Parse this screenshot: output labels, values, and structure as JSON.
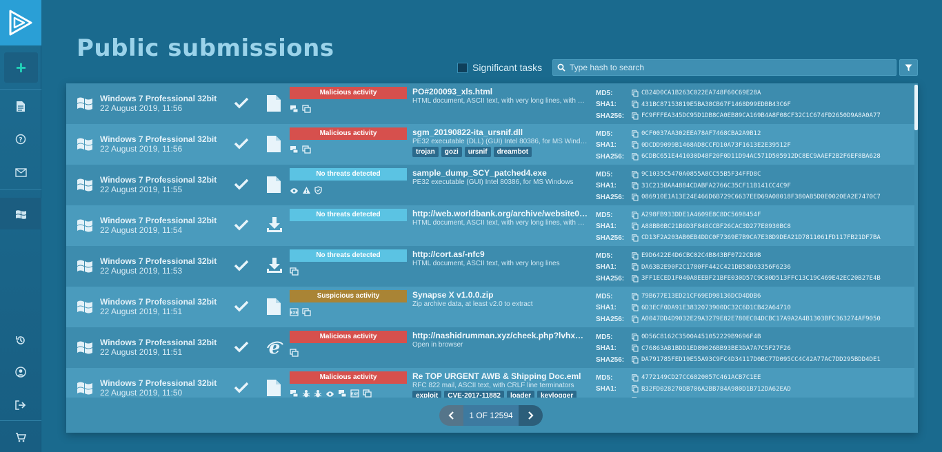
{
  "page": {
    "title": "Public submissions"
  },
  "toolbar": {
    "significant_label": "Significant tasks",
    "search_placeholder": "Type hash to search"
  },
  "hash_labels": {
    "md5": "MD5:",
    "sha1": "SHA1:",
    "sha256": "SHA256:"
  },
  "colors": {
    "malicious": "#d6504d",
    "clean": "#5bc3e3",
    "suspicious": "#a98435"
  },
  "tasks": [
    {
      "os": "Windows 7 Professional 32bit",
      "date": "22 August 2019, 11:56",
      "filetype": "document",
      "verdict": "Malicious activity",
      "verdict_type": "malicious",
      "name": "PO#200093_xls.html",
      "desc": "HTML document, ASCII text, with very long lines, with C...",
      "icons": [
        "network-icon",
        "copy-icon"
      ],
      "tags": [],
      "md5": "CB24D0CA1B263C022EA748F60C69E28A",
      "sha1": "431BC87153819E5BA38CB67F1468D99EDBB43C6F",
      "sha256": "FC9FFFEA345DC95D1DB8CA0EB89CA169B4A8F08CF32C1C674FD2650D9A8A0A77"
    },
    {
      "os": "Windows 7 Professional 32bit",
      "date": "22 August 2019, 11:56",
      "filetype": "document",
      "verdict": "Malicious activity",
      "verdict_type": "malicious",
      "name": "sgm_20190822-ita_ursnif.dll",
      "desc": "PE32 executable (DLL) (GUI) Intel 80386, for MS Windo...",
      "icons": [
        "network-icon",
        "copy-icon"
      ],
      "tags": [
        "trojan",
        "gozi",
        "ursnif",
        "dreambot"
      ],
      "md5": "0CF0037AA302EEA78AF7468CBA2A9B12",
      "sha1": "0DCDD9099B1468AD8CCFD10A73F1613E2E39512F",
      "sha256": "6CDBC651E441030D48F20F0D11D94AC571D505912DC8EC9AAEF2B2F6EF8BA628"
    },
    {
      "os": "Windows 7 Professional 32bit",
      "date": "22 August 2019, 11:55",
      "filetype": "document",
      "verdict": "No threats detected",
      "verdict_type": "clean",
      "name": "sample_dump_SCY_patched4.exe",
      "desc": "PE32 executable (GUI) Intel 80386, for MS Windows",
      "icons": [
        "eye-icon",
        "warning-icon",
        "shield-icon"
      ],
      "tags": [],
      "md5": "9C1035C5470A0855A8CC55B5F34FFD8C",
      "sha1": "31C215BAA4884CDABFA2766C35CF11B141CC4C9F",
      "sha256": "086910E1A13E24E466D6B729C6637EED69A08018F380AB5D0E0020EA2E7470C7"
    },
    {
      "os": "Windows 7 Professional 32bit",
      "date": "22 August 2019, 11:54",
      "filetype": "download",
      "verdict": "No threats detected",
      "verdict_type": "clean",
      "name": "http://web.worldbank.org/archive/website01...",
      "desc": "HTML document, ASCII text, with very long lines, with C...",
      "icons": [],
      "tags": [],
      "md5": "A298FB933DDE1A4609E8C8DC5698454F",
      "sha1": "A88BB0BC21B6D3F848CCBF26CAC3D277E8930BC8",
      "sha256": "CD13F2A203AB0EB4DDC0F7369E7B9CA7E38D9DEA21D7811061FD117FB21DF7BA"
    },
    {
      "os": "Windows 7 Professional 32bit",
      "date": "22 August 2019, 11:53",
      "filetype": "download",
      "verdict": "No threats detected",
      "verdict_type": "clean",
      "name": "http://cort.as/-nfc9",
      "desc": "HTML document, ASCII text, with very long lines",
      "icons": [
        "copy-icon"
      ],
      "tags": [],
      "md5": "E9D6422E4D6CBC02C4B843BF0722CB9B",
      "sha1": "DA63B2E90F2C1780FF442C421DB58D63356F6236",
      "sha256": "3FF1ECED1F040A8EEBF21BFE030D57C9C00D513FFC13C19C469E42EC20B27E4B"
    },
    {
      "os": "Windows 7 Professional 32bit",
      "date": "22 August 2019, 11:51",
      "filetype": "document",
      "verdict": "Suspicious activity",
      "verdict_type": "suspicious",
      "name": "Synapse X v1.0.0.zip",
      "desc": "Zip archive data, at least v2.0 to extract",
      "icons": [
        "exe-icon",
        "copy-icon"
      ],
      "tags": [],
      "md5": "79B677E13ED21CF69ED98136DCD4DDB6",
      "sha1": "6D3ECF0DA91E3832073900DC32C6D1CB42A64710",
      "sha256": "A0047DD4D9032E29A3279E82E780EC04DCBC17A9A2A4B1303BFC363274AF9050"
    },
    {
      "os": "Windows 7 Professional 32bit",
      "date": "22 August 2019, 11:51",
      "filetype": "browser",
      "verdict": "Malicious activity",
      "verdict_type": "malicious",
      "name": "http://nashidrumman.xyz/cheek.php?lvhx=ah...",
      "desc": "Open in browser",
      "icons": [
        "copy-icon"
      ],
      "tags": [],
      "md5": "0D56C8162C3500A451052229B9696F4B",
      "sha1": "C76863AB1BDD1ED89026BB93BE3DA7A7C5F27F26",
      "sha256": "DA791785FED19E55A93C9FC4D34117D0BC77D095CC4C42A77AC7DD295BDD4DE1"
    },
    {
      "os": "Windows 7 Professional 32bit",
      "date": "22 August 2019, 11:50",
      "filetype": "document",
      "verdict": "Malicious activity",
      "verdict_type": "malicious",
      "name": "Re TOP URGENT AWB & Shipping Doc.eml",
      "desc": "RFC 822 mail, ASCII text, with CRLF line terminators",
      "icons": [
        "network-icon",
        "bug-icon",
        "bug-icon",
        "eye-icon",
        "network-icon",
        "exe-icon",
        "copy-icon"
      ],
      "tags": [
        "exploit",
        "CVE-2017-11882",
        "loader",
        "keylogger"
      ],
      "md5": "4772149CD27CC6820057C461ACB7C1EE",
      "sha1": "B32FD028270DB706A2BB784A980D1B712DA62EAD",
      "sha256": ""
    }
  ],
  "pagination": {
    "label": "1 OF 12594"
  }
}
